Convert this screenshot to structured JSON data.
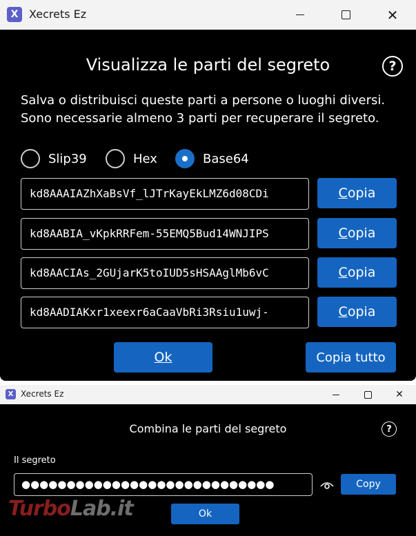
{
  "window1": {
    "title": "Xecrets Ez",
    "app_icon": "X",
    "heading": "Visualizza le parti del segreto",
    "help": "?",
    "description": "Salva o distribuisci queste parti a persone o luoghi diversi. Sono necessarie almeno 3 parti per recuperare il segreto.",
    "format_options": [
      {
        "label": "Slip39",
        "selected": false
      },
      {
        "label": "Hex",
        "selected": false
      },
      {
        "label": "Base64",
        "selected": true
      }
    ],
    "parts": [
      {
        "value": "kd8AAAIAZhXaBsVf_lJTrKayEkLMZ6d08CDi",
        "copy_first": "C",
        "copy_rest": "opia"
      },
      {
        "value": "kd8AABIA_vKpkRRFem-55EMQ5Bud14WNJIPS",
        "copy_first": "C",
        "copy_rest": "opia"
      },
      {
        "value": "kd8AACIAs_2GUjarK5toIUD5sHSAAglMb6vC",
        "copy_first": "C",
        "copy_rest": "opia"
      },
      {
        "value": "kd8AADIAKxr1xeexr6aCaaVbRi3Rsiu1uwj-",
        "copy_first": "C",
        "copy_rest": "opia"
      }
    ],
    "ok_label": "Ok",
    "copy_all_label": "Copia tutto"
  },
  "window2": {
    "title": "Xecrets Ez",
    "app_icon": "X",
    "heading": "Combina le parti del segreto",
    "help": "?",
    "secret_label": "Il segreto",
    "secret_value": "●●●●●●●●●●●●●●●●●●●●●●●●●●●●",
    "copy_label": "Copy",
    "ok_label": "Ok"
  },
  "watermark": {
    "part1": "Turbo",
    "part2": "Lab.it"
  },
  "colors": {
    "accent": "#1565c0",
    "radio_selected": "#1a6fc9",
    "background": "#000000",
    "titlebar": "#f3f3f3"
  }
}
